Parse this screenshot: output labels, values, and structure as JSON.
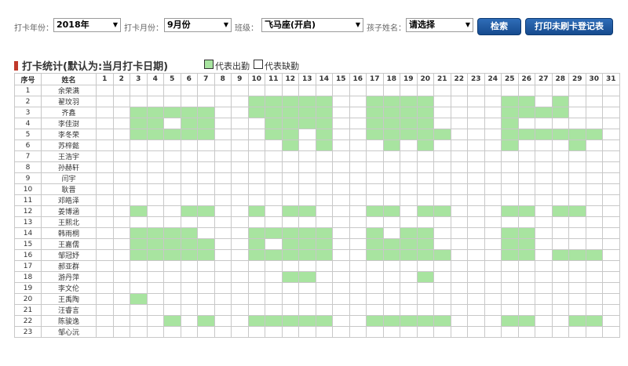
{
  "filters": {
    "year_label": "打卡年份：",
    "year_value": "2018年",
    "month_label": "打卡月份：",
    "month_value": "9月份",
    "class_label": "班级：",
    "class_value": "飞马座(开启)",
    "child_label": "孩子姓名：",
    "child_value": "请选择",
    "dropdown_arrow": "▼"
  },
  "buttons": {
    "search": "检索",
    "print": "打印未刷卡登记表"
  },
  "section": {
    "title": "打卡统计(默认为:当月打卡日期)",
    "legend_present": "代表出勤",
    "legend_absent": "代表缺勤"
  },
  "colors": {
    "present": "#a8e4a0",
    "accent": "#1f5ea8",
    "title_mark": "#c0392b"
  },
  "table": {
    "header_index": "序号",
    "header_name": "姓名",
    "days": [
      "1",
      "2",
      "3",
      "4",
      "5",
      "6",
      "7",
      "8",
      "9",
      "10",
      "11",
      "12",
      "13",
      "14",
      "15",
      "16",
      "17",
      "18",
      "19",
      "20",
      "21",
      "22",
      "23",
      "24",
      "25",
      "26",
      "27",
      "28",
      "29",
      "30",
      "31"
    ],
    "rows": [
      {
        "no": "1",
        "name": "余荣满",
        "present": []
      },
      {
        "no": "2",
        "name": "翟玟羽",
        "present": [
          10,
          11,
          12,
          13,
          14,
          17,
          18,
          19,
          20,
          25,
          26,
          28
        ]
      },
      {
        "no": "3",
        "name": "齐鑫",
        "present": [
          3,
          4,
          5,
          6,
          7,
          10,
          11,
          12,
          13,
          14,
          17,
          18,
          19,
          20,
          25,
          26,
          27,
          28
        ]
      },
      {
        "no": "4",
        "name": "李佳澍",
        "present": [
          3,
          4,
          6,
          7,
          11,
          12,
          13,
          14,
          17,
          18,
          19,
          20,
          25
        ]
      },
      {
        "no": "5",
        "name": "李冬荣",
        "present": [
          3,
          4,
          5,
          6,
          7,
          11,
          12,
          14,
          17,
          18,
          19,
          20,
          21,
          25,
          26,
          27,
          28,
          29,
          30
        ]
      },
      {
        "no": "6",
        "name": "苏梓懿",
        "present": [
          12,
          14,
          18,
          20,
          25,
          29
        ]
      },
      {
        "no": "7",
        "name": "王浩宇",
        "present": []
      },
      {
        "no": "8",
        "name": "孙赫轩",
        "present": []
      },
      {
        "no": "9",
        "name": "闫宇",
        "present": []
      },
      {
        "no": "10",
        "name": "耿晋",
        "present": []
      },
      {
        "no": "11",
        "name": "邓皓泽",
        "present": []
      },
      {
        "no": "12",
        "name": "姜博涵",
        "present": [
          3,
          6,
          7,
          10,
          12,
          13,
          17,
          18,
          20,
          21,
          25,
          26,
          28,
          29
        ]
      },
      {
        "no": "13",
        "name": "王熙北",
        "present": []
      },
      {
        "no": "14",
        "name": "韩雨桐",
        "present": [
          3,
          4,
          5,
          6,
          10,
          11,
          12,
          13,
          14,
          17,
          19,
          20,
          25,
          26
        ]
      },
      {
        "no": "15",
        "name": "王嘉儒",
        "present": [
          3,
          4,
          5,
          6,
          7,
          10,
          12,
          13,
          14,
          17,
          18,
          19,
          20,
          25,
          26
        ]
      },
      {
        "no": "16",
        "name": "邹冠妤",
        "present": [
          3,
          4,
          5,
          6,
          7,
          10,
          11,
          12,
          13,
          14,
          17,
          18,
          19,
          20,
          21,
          25,
          26,
          28,
          29,
          30
        ]
      },
      {
        "no": "17",
        "name": "郝亚群",
        "present": []
      },
      {
        "no": "18",
        "name": "游丹萍",
        "present": [
          12,
          13,
          20
        ]
      },
      {
        "no": "19",
        "name": "李文伦",
        "present": []
      },
      {
        "no": "20",
        "name": "王禹陶",
        "present": [
          3
        ]
      },
      {
        "no": "21",
        "name": "汪睿言",
        "present": []
      },
      {
        "no": "22",
        "name": "陈骏逸",
        "present": [
          5,
          7,
          10,
          11,
          12,
          13,
          14,
          17,
          18,
          19,
          20,
          21,
          25,
          26,
          29,
          30
        ]
      },
      {
        "no": "23",
        "name": "邹心沅",
        "present": []
      }
    ]
  }
}
